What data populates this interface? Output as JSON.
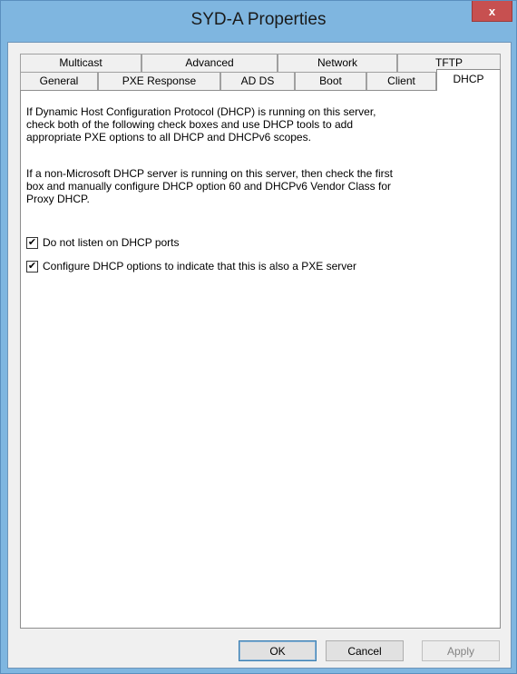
{
  "window": {
    "title": "SYD-A Properties",
    "close_glyph": "x"
  },
  "tabs": {
    "row_back": [
      {
        "label": "Multicast"
      },
      {
        "label": "Advanced"
      },
      {
        "label": "Network"
      },
      {
        "label": "TFTP"
      }
    ],
    "row_front": [
      {
        "label": "General"
      },
      {
        "label": "PXE Response"
      },
      {
        "label": "AD DS"
      },
      {
        "label": "Boot"
      },
      {
        "label": "Client"
      },
      {
        "label": "DHCP"
      }
    ],
    "selected": "DHCP"
  },
  "panel": {
    "paragraph1": [
      "If Dynamic Host Configuration Protocol (DHCP) is running on this server,",
      "check both of the following check boxes and use DHCP tools to add",
      "appropriate PXE options to all DHCP and DHCPv6 scopes."
    ],
    "paragraph2": [
      "If a non-Microsoft DHCP server is running on this server, then check the first",
      "box and manually configure DHCP option 60 and DHCPv6 Vendor Class for",
      "Proxy DHCP."
    ],
    "checkbox1": {
      "label": "Do not listen on DHCP ports",
      "checked": true,
      "mark": "✔"
    },
    "checkbox2": {
      "label": "Configure DHCP options to indicate that this is also a PXE server",
      "checked": true,
      "mark": "✔"
    }
  },
  "buttons": {
    "ok": "OK",
    "cancel": "Cancel",
    "apply": "Apply"
  },
  "colors": {
    "frame": "#7fb6e0",
    "close_button": "#c75050"
  }
}
